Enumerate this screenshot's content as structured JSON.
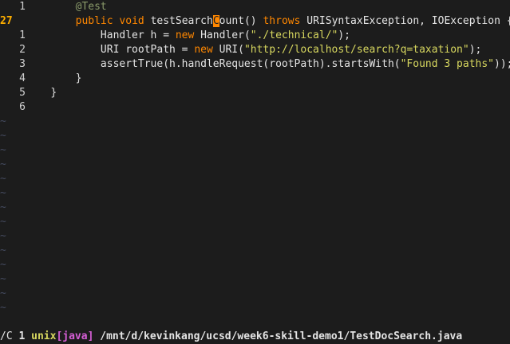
{
  "lines": [
    {
      "num": "1",
      "indent": "    ",
      "tokens": [
        {
          "c": "anno",
          "t": "@Test"
        }
      ]
    },
    {
      "num": "27",
      "current": true,
      "indent": "    ",
      "tokens": [
        {
          "c": "kw",
          "t": "public "
        },
        {
          "c": "kw",
          "t": "void "
        },
        {
          "c": "fn",
          "t": "testSearch"
        },
        {
          "c": "cursor",
          "t": "C"
        },
        {
          "c": "fn",
          "t": "ount() "
        },
        {
          "c": "kw",
          "t": "throws "
        },
        {
          "c": "ty",
          "t": "URISyntaxException, IOException {"
        }
      ]
    },
    {
      "num": "1",
      "indent": "        ",
      "tokens": [
        {
          "c": "ty",
          "t": "Handler h = "
        },
        {
          "c": "kw",
          "t": "new "
        },
        {
          "c": "ty",
          "t": "Handler("
        },
        {
          "c": "str",
          "t": "\"./technical/\""
        },
        {
          "c": "plain",
          "t": ");"
        }
      ]
    },
    {
      "num": "2",
      "indent": "        ",
      "tokens": [
        {
          "c": "ty",
          "t": "URI rootPath = "
        },
        {
          "c": "kw",
          "t": "new "
        },
        {
          "c": "ty",
          "t": "URI("
        },
        {
          "c": "str",
          "t": "\"http://localhost/search?q=taxation\""
        },
        {
          "c": "plain",
          "t": ");"
        }
      ]
    },
    {
      "num": "3",
      "indent": "        ",
      "tokens": [
        {
          "c": "plain",
          "t": "assertTrue(h.handleRequest(rootPath).startsWith("
        },
        {
          "c": "str",
          "t": "\"Found 3 paths\""
        },
        {
          "c": "plain",
          "t": "));"
        }
      ]
    },
    {
      "num": "4",
      "indent": "    ",
      "tokens": [
        {
          "c": "plain",
          "t": "}"
        }
      ]
    },
    {
      "num": "5",
      "indent": "",
      "tokens": [
        {
          "c": "plain",
          "t": "}"
        }
      ]
    },
    {
      "num": "6",
      "indent": "",
      "tokens": []
    }
  ],
  "empty_marker": "~",
  "empty_line_count": 14,
  "statusline": {
    "line_num": " 1 ",
    "fileformat": "unix",
    "filetype": "[java]",
    "path": " /mnt/d/kevinkang/ucsd/week6-skill-demo1/TestDocSearch.java"
  },
  "cmdline": "/C"
}
